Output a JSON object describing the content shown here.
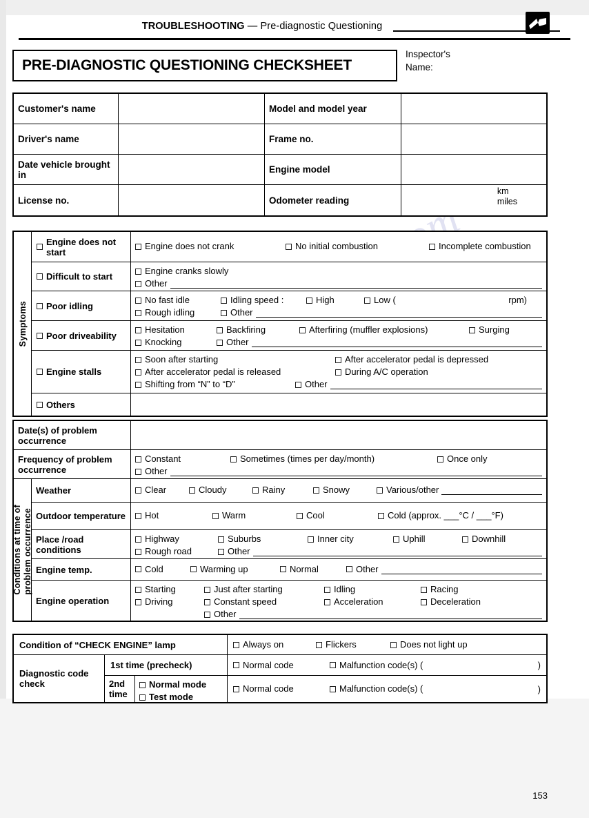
{
  "header": {
    "title_bold": "TROUBLESHOOTING",
    "title_dash": " — ",
    "title_sub": "Pre-diagnostic Questioning",
    "logo_icon": "open-book-icon"
  },
  "title_band": {
    "checksheet_title": "PRE-DIAGNOSTIC QUESTIONING CHECKSHEET",
    "inspector_line1": "Inspector's",
    "inspector_line2": "Name:"
  },
  "customer_table": {
    "rows": [
      {
        "label_left": "Customer's name",
        "value_left": "",
        "label_right": "Model and model year",
        "value_right": ""
      },
      {
        "label_left": "Driver's  name",
        "value_left": "",
        "label_right": "Frame no.",
        "value_right": ""
      },
      {
        "label_left": "Date vehicle brought in",
        "value_left": "",
        "label_right": "Engine model",
        "value_right": ""
      },
      {
        "label_left": "License no.",
        "value_left": "",
        "label_right": "Odometer reading",
        "value_right": ""
      }
    ],
    "odometer_unit_1": "km",
    "odometer_unit_2": "miles"
  },
  "symptoms": {
    "side_label": "Symptoms",
    "rows": [
      {
        "name": "Engine  does not start",
        "lines": [
          {
            "options": [
              "Engine does not crank",
              "No initial combustion",
              "Incomplete combustion"
            ],
            "rule": false
          }
        ]
      },
      {
        "name": "Difficult to start",
        "lines": [
          {
            "options": [
              "Engine cranks slowly"
            ],
            "rule": false
          },
          {
            "options": [
              "Other"
            ],
            "rule": true
          }
        ]
      },
      {
        "name": "Poor idling",
        "lines": [
          {
            "options": [
              "No fast idle",
              "Idling speed :",
              "High",
              "Low ("
            ],
            "rule": false,
            "trailing": "rpm)"
          },
          {
            "options": [
              "Rough idling",
              "Other"
            ],
            "rule": true
          }
        ]
      },
      {
        "name": "Poor driveability",
        "lines": [
          {
            "options": [
              "Hesitation",
              "Backfiring",
              "Afterfiring (muffler explosions)",
              "Surging"
            ],
            "rule": false
          },
          {
            "options": [
              "Knocking",
              "Other"
            ],
            "rule": true
          }
        ]
      },
      {
        "name": "Engine stalls",
        "lines": [
          {
            "options": [
              "Soon after starting",
              "After accelerator pedal is depressed"
            ],
            "rule": false
          },
          {
            "options": [
              "After accelerator pedal is released",
              "During A/C operation"
            ],
            "rule": false
          },
          {
            "options": [
              "Shifting from “N” to “D”",
              "Other"
            ],
            "rule": true
          }
        ]
      },
      {
        "name": "Others",
        "lines": []
      }
    ]
  },
  "conditions": {
    "side_label_line1": "Conditions at time of",
    "side_label_line2": "problem occurrence",
    "date_label": "Date(s) of problem occurrence",
    "date_value": "",
    "frequency_label": "Frequency of problem occurrence",
    "frequency_line1": [
      "Constant",
      "Sometimes (times per day/month)",
      "Once only"
    ],
    "frequency_line2": [
      "Other"
    ],
    "rows": [
      {
        "label": "Weather",
        "line1": [
          "Clear",
          "Cloudy",
          "Rainy",
          "Snowy",
          "Various/other"
        ],
        "rule1": true,
        "line2": []
      },
      {
        "label": "Outdoor temperature",
        "line1": [
          "Hot",
          "Warm",
          "Cool",
          "Cold (approx. ___°C / ___°F)"
        ],
        "rule1": false,
        "line2": []
      },
      {
        "label": "Place /road conditions",
        "line1": [
          "Highway",
          "Suburbs",
          "Inner city",
          "Uphill",
          "Downhill"
        ],
        "rule1": false,
        "line2": [
          "Rough road",
          "Other"
        ],
        "rule2": true
      },
      {
        "label": "Engine temp.",
        "line1": [
          "Cold",
          "Warming up",
          "Normal",
          "Other"
        ],
        "rule1": true,
        "line2": []
      },
      {
        "label": "Engine operation",
        "line1": [
          "Starting",
          "Just after starting",
          "Idling",
          "Racing"
        ],
        "rule1": false,
        "line2": [
          "Driving",
          "Constant speed",
          "Acceleration",
          "Deceleration"
        ],
        "rule2": false,
        "line3": [
          "Other"
        ],
        "rule3": true
      }
    ]
  },
  "check_engine": {
    "lamp_label": "Condition of “CHECK ENGINE” lamp",
    "lamp_options": [
      "Always on",
      "Flickers",
      "Does not light up"
    ],
    "diagnostic_label": "Diagnostic code check",
    "first_time_label": "1st time (precheck)",
    "first_time_options": [
      "Normal code",
      "Malfunction code(s) ("
    ],
    "first_time_close": ")",
    "second_time_label": "2nd time",
    "second_time_modes": [
      "Normal mode",
      "Test  mode"
    ],
    "second_time_options": [
      "Normal code",
      "Malfunction code(s) ("
    ],
    "second_time_close": ")"
  },
  "footer": {
    "page_number": "153"
  }
}
